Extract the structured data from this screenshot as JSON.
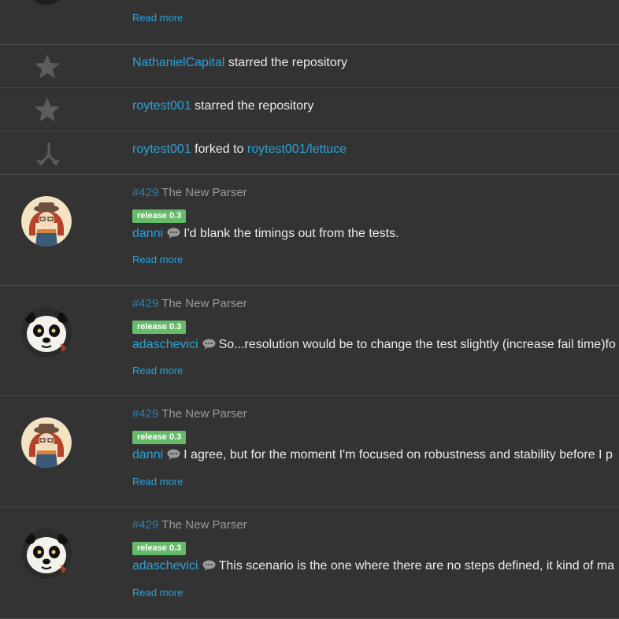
{
  "top_partial": {
    "read_more": "Read more"
  },
  "events": [
    {
      "user": "NathanielCapital",
      "action": "starred the repository",
      "icon": "star-icon"
    },
    {
      "user": "roytest001",
      "action": "starred the repository",
      "icon": "star-icon"
    },
    {
      "user": "roytest001",
      "action": "forked to",
      "target": "roytest001/lettuce",
      "icon": "fork-icon"
    }
  ],
  "comments": [
    {
      "issue_number": "#429",
      "issue_title": "The New Parser",
      "label": "release 0.3",
      "user": "danni",
      "avatar": "danni-avatar",
      "text": "I'd blank the timings out from the tests.",
      "read_more": "Read more"
    },
    {
      "issue_number": "#429",
      "issue_title": "The New Parser",
      "label": "release 0.3",
      "user": "adaschevici",
      "avatar": "panda-avatar",
      "text": "So...resolution would be to change the test slightly (increase fail time)fo",
      "read_more": "Read more"
    },
    {
      "issue_number": "#429",
      "issue_title": "The New Parser",
      "label": "release 0.3",
      "user": "danni",
      "avatar": "danni-avatar",
      "text": "I agree, but for the moment I'm focused on robustness and stability before I p",
      "read_more": "Read more"
    },
    {
      "issue_number": "#429",
      "issue_title": "The New Parser",
      "label": "release 0.3",
      "user": "adaschevici",
      "avatar": "panda-avatar",
      "text": "This scenario is the one where there are no steps defined, it kind of ma",
      "read_more": "Read more"
    }
  ],
  "colors": {
    "background": "#333333",
    "link": "#2aa3d9",
    "label_green": "#66bb6a",
    "muted_icon": "#5c5c5c"
  }
}
